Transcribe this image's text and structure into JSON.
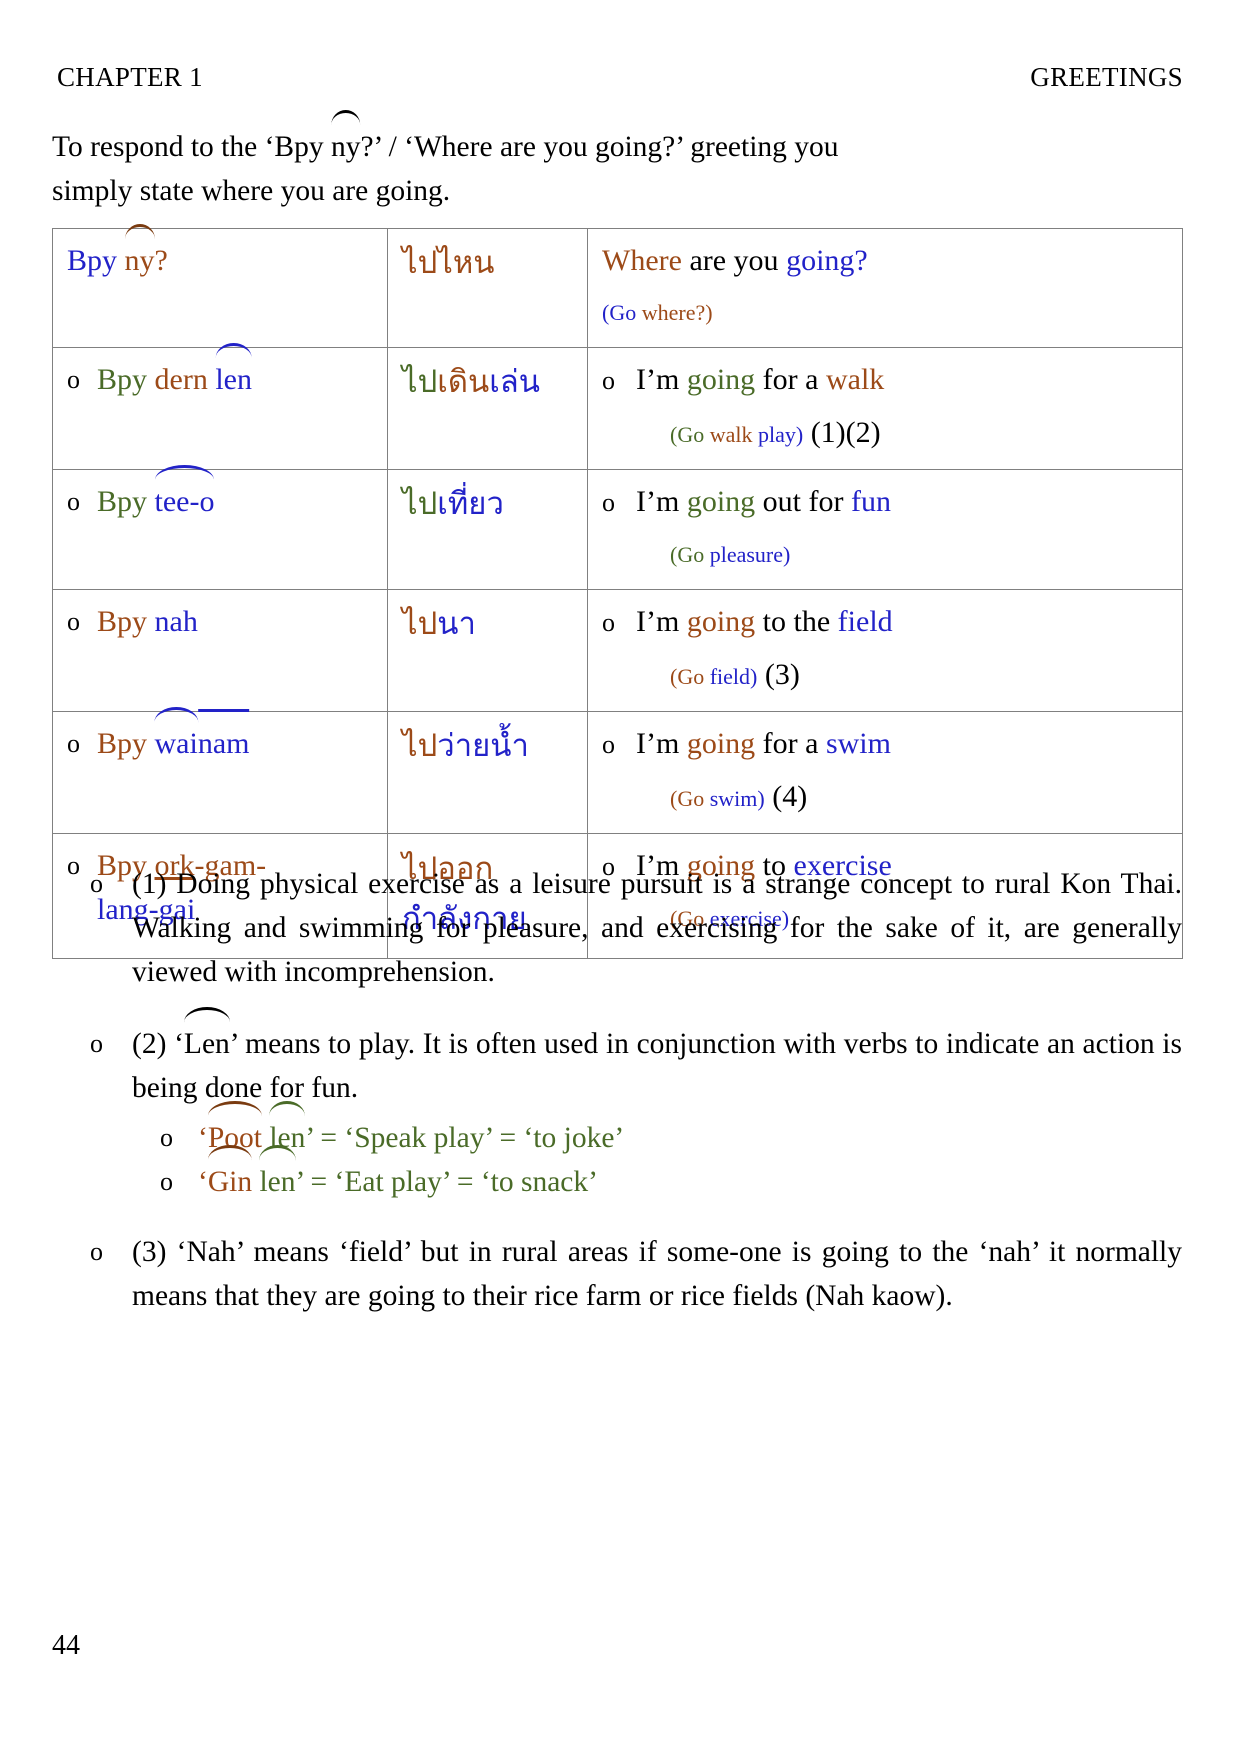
{
  "header": {
    "left": "CHAPTER 1",
    "right": "GREETINGS"
  },
  "intro": {
    "part1": "To respond to the ‘Bpy ",
    "ny_word": "ny",
    "part2": "?’ / ‘Where are you going?’ greeting you",
    "line2": "simply state where you are going."
  },
  "table": {
    "header": {
      "roman_blue": "Bpy ",
      "roman_brown": "ny",
      "roman_tail": "?",
      "thai": "ไปไหน",
      "en_where": "Where",
      "en_mid": " are you ",
      "en_going": "going?",
      "gloss_go": "(Go ",
      "gloss_rest": "where?)"
    },
    "rows": [
      {
        "bullet": "o",
        "roman": [
          {
            "text": "Bpy ",
            "color": "green",
            "mark": "none"
          },
          {
            "text": "dern ",
            "color": "brown",
            "mark": "none"
          },
          {
            "text": "len",
            "color": "blue",
            "mark": "curve"
          }
        ],
        "thai": [
          {
            "text": "ไป",
            "color": "green"
          },
          {
            "text": "เดิน",
            "color": "brown"
          },
          {
            "text": "เล่น",
            "color": "blue"
          }
        ],
        "english": [
          {
            "text": "I’m ",
            "color": "black"
          },
          {
            "text": "going",
            "color": "green"
          },
          {
            "text": " for a ",
            "color": "black"
          },
          {
            "text": "walk",
            "color": "brown"
          }
        ],
        "gloss": [
          {
            "text": "(Go ",
            "color": "green"
          },
          {
            "text": "walk ",
            "color": "brown"
          },
          {
            "text": "play)",
            "color": "blue"
          }
        ],
        "refs": " (1)(2)"
      },
      {
        "bullet": "o",
        "roman": [
          {
            "text": "Bpy ",
            "color": "green",
            "mark": "none"
          },
          {
            "text": "tee-o",
            "color": "blue",
            "mark": "curve"
          }
        ],
        "thai": [
          {
            "text": "ไป",
            "color": "green"
          },
          {
            "text": "เที่ยว",
            "color": "blue"
          }
        ],
        "english": [
          {
            "text": "I’m ",
            "color": "black"
          },
          {
            "text": "going",
            "color": "green"
          },
          {
            "text": " out for ",
            "color": "black"
          },
          {
            "text": "fun",
            "color": "blue"
          }
        ],
        "gloss": [
          {
            "text": "(Go ",
            "color": "green"
          },
          {
            "text": "pleasure)",
            "color": "blue"
          }
        ],
        "refs": ""
      },
      {
        "bullet": "o",
        "roman": [
          {
            "text": "Bpy ",
            "color": "brown",
            "mark": "none"
          },
          {
            "text": "nah",
            "color": "blue",
            "mark": "none"
          }
        ],
        "thai": [
          {
            "text": "ไป",
            "color": "brown"
          },
          {
            "text": "นา",
            "color": "blue"
          }
        ],
        "english": [
          {
            "text": "I’m ",
            "color": "black"
          },
          {
            "text": "going",
            "color": "brown"
          },
          {
            "text": " to the ",
            "color": "black"
          },
          {
            "text": "field",
            "color": "blue"
          }
        ],
        "gloss": [
          {
            "text": "(Go ",
            "color": "brown"
          },
          {
            "text": "field)",
            "color": "blue"
          }
        ],
        "refs": " (3)"
      },
      {
        "bullet": "o",
        "roman": [
          {
            "text": "Bpy ",
            "color": "brown",
            "mark": "none"
          },
          {
            "text": "wai ",
            "color": "blue",
            "mark": "curve"
          },
          {
            "text": "nam",
            "color": "blue",
            "mark": "bar"
          }
        ],
        "thai": [
          {
            "text": "ไป",
            "color": "brown"
          },
          {
            "text": "ว่ายน้ำ",
            "color": "blue"
          }
        ],
        "english": [
          {
            "text": "I’m ",
            "color": "black"
          },
          {
            "text": "going",
            "color": "brown"
          },
          {
            "text": " for a ",
            "color": "black"
          },
          {
            "text": "swim",
            "color": "blue"
          }
        ],
        "gloss": [
          {
            "text": "(Go ",
            "color": "brown"
          },
          {
            "text": "swim)",
            "color": "blue"
          }
        ],
        "refs": " (4)"
      },
      {
        "bullet": "o",
        "roman": [
          {
            "text": "Bpy ",
            "color": "brown",
            "mark": "none"
          },
          {
            "text": "ork",
            "color": "brown",
            "mark": "underline"
          },
          {
            "text": "-gam-",
            "color": "brown",
            "mark": "none"
          },
          {
            "text": "lang-gai",
            "color": "blue",
            "mark": "none",
            "newline": true
          }
        ],
        "thai": [
          {
            "text": "ไปออก",
            "color": "brown"
          },
          {
            "text": "กำลังกาย",
            "color": "blue",
            "newline": true
          }
        ],
        "english": [
          {
            "text": "I’m ",
            "color": "black"
          },
          {
            "text": "going",
            "color": "brown"
          },
          {
            "text": " to ",
            "color": "black"
          },
          {
            "text": "exercise",
            "color": "blue"
          }
        ],
        "gloss": [
          {
            "text": "(Go ",
            "color": "brown"
          },
          {
            "text": "exercise)",
            "color": "blue"
          }
        ],
        "refs": ""
      }
    ]
  },
  "notes": [
    {
      "bullet": "o",
      "text": "(1) Doing physical exercise as a leisure pursuit is a strange concept to rural Kon Thai. Walking and swimming for pleasure, and exercising for the sake of it, are generally viewed with incomprehension."
    },
    {
      "bullet": "o",
      "text_pre": "(2) ‘",
      "marked": "Len",
      "text_post": "’ means to play. It is often used in conjunction with verbs to indicate an action is being done for fun.",
      "subitems": [
        {
          "bullet": "o",
          "p1": "‘",
          "m1": "Poot",
          "p2": " ",
          "m2": "len",
          "p3": "’ = ‘Speak play’ = ‘to joke’",
          "color1": "brown",
          "color2": "green",
          "tail_color": "green"
        },
        {
          "bullet": "o",
          "p1": "‘",
          "m1": "Gin",
          "p2": " ",
          "m2": "len",
          "p3": "’ = ‘Eat play’ = ‘to snack’",
          "color1": "brown",
          "color2": "green",
          "tail_color": "green"
        }
      ]
    },
    {
      "bullet": "o",
      "text": "(3) ‘Nah’ means ‘field’ but in rural areas if some-one is going to the ‘nah’ it normally means that they are going to their rice farm or rice fields (Nah kaow)."
    }
  ],
  "folio": "44"
}
